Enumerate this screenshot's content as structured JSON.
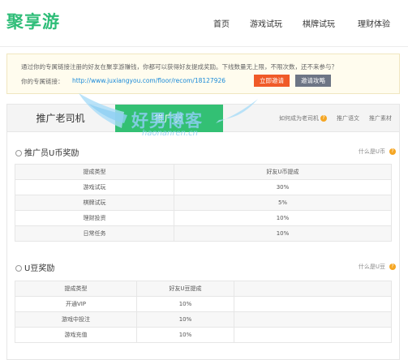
{
  "header": {
    "logo": "聚享游",
    "nav": [
      "首页",
      "游戏试玩",
      "棋牌试玩",
      "理财体验"
    ]
  },
  "info": {
    "text": "通过你的专属链接注册的好友在聚享游赚钱，你都可以获得好友提成奖励。下线数量无上限，不限次数，还不来参与？",
    "link_label": "你的专属链接：",
    "link_url": "http://www.juxiangyou.com/floor/recom/18127926",
    "invite_button": "立即邀请",
    "strategy_button": "邀请攻略"
  },
  "tabs": {
    "tab_old": "推广老司机",
    "tab_active": "推广员",
    "link_become": "如何成为老司机",
    "link_copy": "推广语文",
    "link_material": "推广素材"
  },
  "ucoin": {
    "title": "推广员U币奖励",
    "what": "什么是U币",
    "headers": [
      "提成类型",
      "好友U币提成"
    ],
    "rows": [
      [
        "游戏试玩",
        "30%"
      ],
      [
        "棋牌试玩",
        "5%"
      ],
      [
        "理财投资",
        "10%"
      ],
      [
        "日常任务",
        "10%"
      ]
    ]
  },
  "ubean": {
    "title": "U豆奖励",
    "what": "什么是U豆",
    "headers": [
      "提成类型",
      "好友U豆提成"
    ],
    "rows": [
      [
        "开通VIP",
        "10%"
      ],
      [
        "游戏中投注",
        "10%"
      ],
      [
        "游戏充值",
        "10%"
      ]
    ]
  },
  "watermark": {
    "text": "好男博客",
    "sub": "haonanren.cn"
  },
  "colors": {
    "brand_green": "#2ebd78",
    "tab_active": "#33c074",
    "invite": "#f05a28",
    "strategy": "#6d7585",
    "link": "#1a8ad8",
    "help": "#f5a623"
  }
}
